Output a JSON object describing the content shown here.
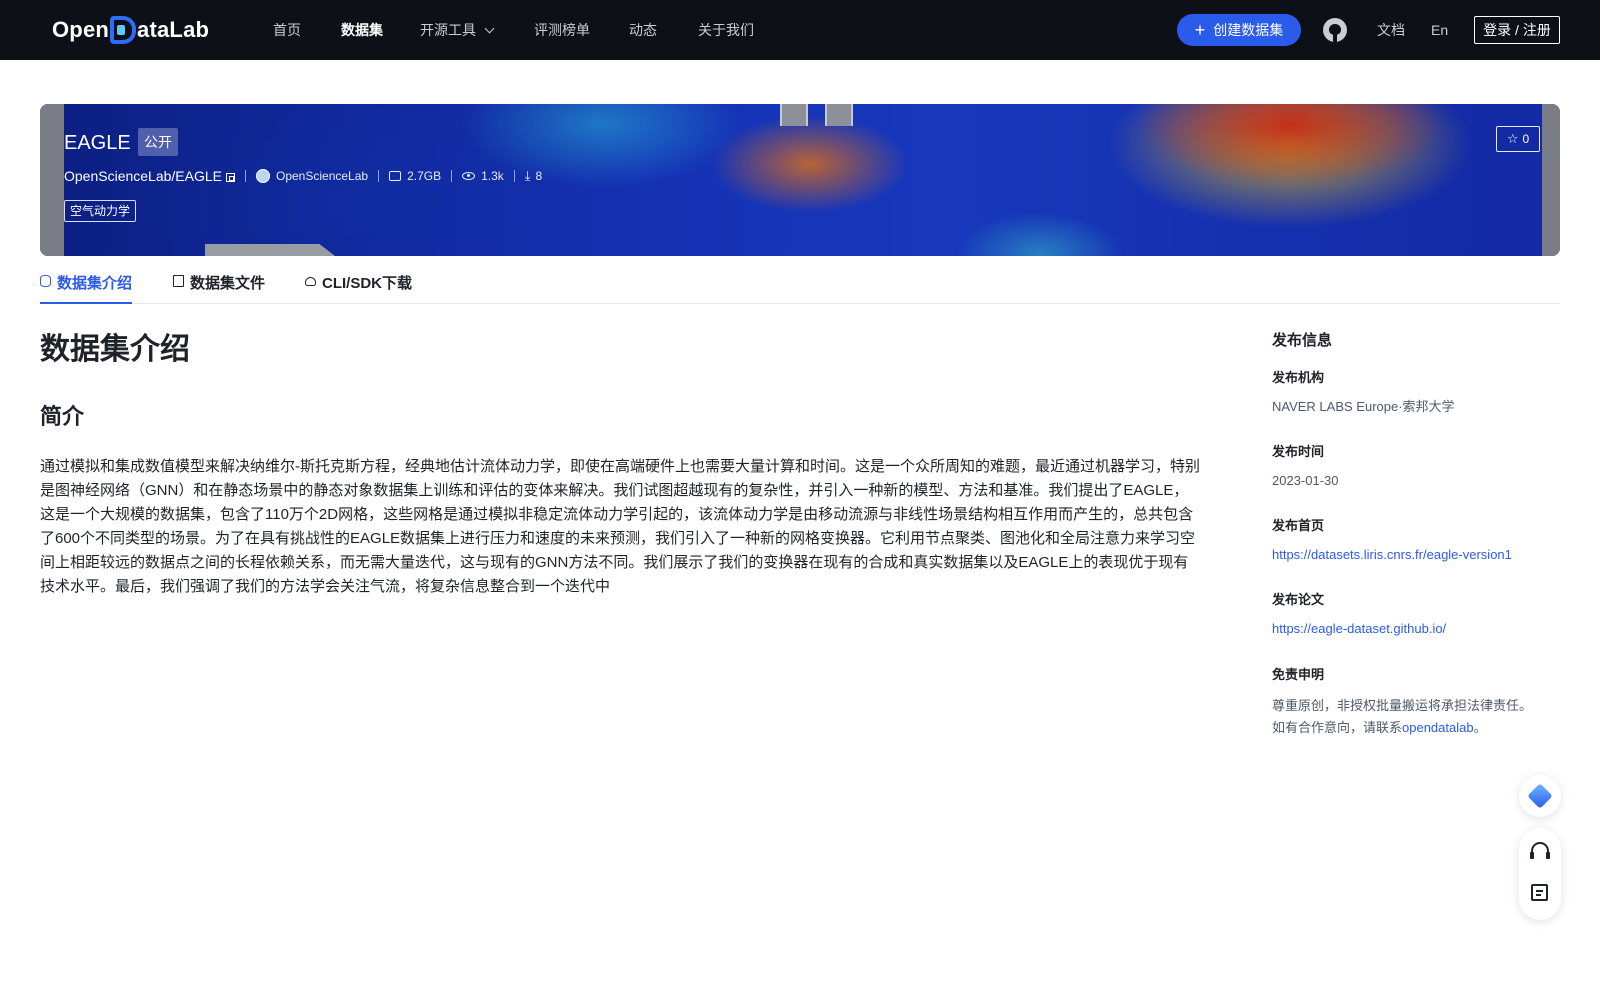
{
  "nav": {
    "logo_text": "OpenDataLab",
    "items": [
      "首页",
      "数据集",
      "开源工具",
      "评测榜单",
      "动态",
      "关于我们"
    ],
    "active": "数据集",
    "create_label": "创建数据集",
    "docs": "文档",
    "lang": "En",
    "login": "登录 / 注册"
  },
  "banner": {
    "title": "EAGLE",
    "visibility": "公开",
    "repo": "OpenScienceLab/EAGLE",
    "org": "OpenScienceLab",
    "size": "2.7GB",
    "views": "1.3k",
    "downloads": "8",
    "stars": "0",
    "tag": "空气动力学"
  },
  "tabs": [
    "数据集介绍",
    "数据集文件",
    "CLI/SDK下载"
  ],
  "main": {
    "heading": "数据集介绍",
    "subheading": "简介",
    "description": "通过模拟和集成数值模型来解决纳维尔-斯托克斯方程，经典地估计流体动力学，即使在高端硬件上也需要大量计算和时间。这是一个众所周知的难题，最近通过机器学习，特别是图神经网络（GNN）和在静态场景中的静态对象数据集上训练和评估的变体来解决。我们试图超越现有的复杂性，并引入一种新的模型、方法和基准。我们提出了EAGLE，这是一个大规模的数据集，包含了110万个2D网格，这些网格是通过模拟非稳定流体动力学引起的，该流体动力学是由移动流源与非线性场景结构相互作用而产生的，总共包含了600个不同类型的场景。为了在具有挑战性的EAGLE数据集上进行压力和速度的未来预测，我们引入了一种新的网格变换器。它利用节点聚类、图池化和全局注意力来学习空间上相距较远的数据点之间的长程依赖关系，而无需大量迭代，这与现有的GNN方法不同。我们展示了我们的变换器在现有的合成和真实数据集以及EAGLE上的表现优于现有技术水平。最后，我们强调了我们的方法学会关注气流，将复杂信息整合到一个迭代中"
  },
  "sidebar": {
    "title": "发布信息",
    "publisher_label": "发布机构",
    "publisher": "NAVER LABS Europe·索邦大学",
    "date_label": "发布时间",
    "date": "2023-01-30",
    "homepage_label": "发布首页",
    "homepage": "https://datasets.liris.cnrs.fr/eagle-version1",
    "paper_label": "发布论文",
    "paper": "https://eagle-dataset.github.io/",
    "disclaimer_label": "免责申明",
    "disclaimer_line1": "尊重原创，非授权批量搬运将承担法律责任。",
    "disclaimer_line2_pre": "如有合作意向，请联系",
    "disclaimer_link": "opendatalab",
    "disclaimer_line2_post": "。"
  },
  "colors": {
    "nav_bg": "#0d1117",
    "accent": "#2b5bea"
  },
  "icons": [
    "github-icon",
    "plus-icon",
    "star-icon",
    "copy-icon",
    "storage-icon",
    "eye-icon",
    "download-icon",
    "database-icon",
    "file-icon",
    "cloud-icon",
    "diamond-icon",
    "headset-icon",
    "edit-icon"
  ]
}
